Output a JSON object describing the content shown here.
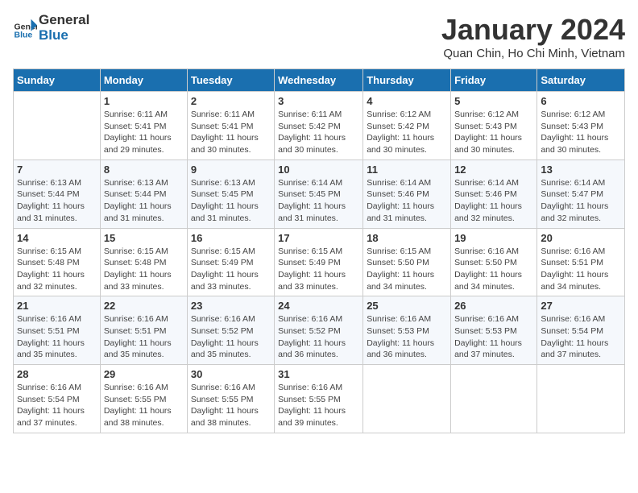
{
  "header": {
    "logo_general": "General",
    "logo_blue": "Blue",
    "month_title": "January 2024",
    "location": "Quan Chin, Ho Chi Minh, Vietnam"
  },
  "days_of_week": [
    "Sunday",
    "Monday",
    "Tuesday",
    "Wednesday",
    "Thursday",
    "Friday",
    "Saturday"
  ],
  "weeks": [
    [
      {
        "day": "",
        "info": ""
      },
      {
        "day": "1",
        "info": "Sunrise: 6:11 AM\nSunset: 5:41 PM\nDaylight: 11 hours\nand 29 minutes."
      },
      {
        "day": "2",
        "info": "Sunrise: 6:11 AM\nSunset: 5:41 PM\nDaylight: 11 hours\nand 30 minutes."
      },
      {
        "day": "3",
        "info": "Sunrise: 6:11 AM\nSunset: 5:42 PM\nDaylight: 11 hours\nand 30 minutes."
      },
      {
        "day": "4",
        "info": "Sunrise: 6:12 AM\nSunset: 5:42 PM\nDaylight: 11 hours\nand 30 minutes."
      },
      {
        "day": "5",
        "info": "Sunrise: 6:12 AM\nSunset: 5:43 PM\nDaylight: 11 hours\nand 30 minutes."
      },
      {
        "day": "6",
        "info": "Sunrise: 6:12 AM\nSunset: 5:43 PM\nDaylight: 11 hours\nand 30 minutes."
      }
    ],
    [
      {
        "day": "7",
        "info": "Sunrise: 6:13 AM\nSunset: 5:44 PM\nDaylight: 11 hours\nand 31 minutes."
      },
      {
        "day": "8",
        "info": "Sunrise: 6:13 AM\nSunset: 5:44 PM\nDaylight: 11 hours\nand 31 minutes."
      },
      {
        "day": "9",
        "info": "Sunrise: 6:13 AM\nSunset: 5:45 PM\nDaylight: 11 hours\nand 31 minutes."
      },
      {
        "day": "10",
        "info": "Sunrise: 6:14 AM\nSunset: 5:45 PM\nDaylight: 11 hours\nand 31 minutes."
      },
      {
        "day": "11",
        "info": "Sunrise: 6:14 AM\nSunset: 5:46 PM\nDaylight: 11 hours\nand 31 minutes."
      },
      {
        "day": "12",
        "info": "Sunrise: 6:14 AM\nSunset: 5:46 PM\nDaylight: 11 hours\nand 32 minutes."
      },
      {
        "day": "13",
        "info": "Sunrise: 6:14 AM\nSunset: 5:47 PM\nDaylight: 11 hours\nand 32 minutes."
      }
    ],
    [
      {
        "day": "14",
        "info": "Sunrise: 6:15 AM\nSunset: 5:48 PM\nDaylight: 11 hours\nand 32 minutes."
      },
      {
        "day": "15",
        "info": "Sunrise: 6:15 AM\nSunset: 5:48 PM\nDaylight: 11 hours\nand 33 minutes."
      },
      {
        "day": "16",
        "info": "Sunrise: 6:15 AM\nSunset: 5:49 PM\nDaylight: 11 hours\nand 33 minutes."
      },
      {
        "day": "17",
        "info": "Sunrise: 6:15 AM\nSunset: 5:49 PM\nDaylight: 11 hours\nand 33 minutes."
      },
      {
        "day": "18",
        "info": "Sunrise: 6:15 AM\nSunset: 5:50 PM\nDaylight: 11 hours\nand 34 minutes."
      },
      {
        "day": "19",
        "info": "Sunrise: 6:16 AM\nSunset: 5:50 PM\nDaylight: 11 hours\nand 34 minutes."
      },
      {
        "day": "20",
        "info": "Sunrise: 6:16 AM\nSunset: 5:51 PM\nDaylight: 11 hours\nand 34 minutes."
      }
    ],
    [
      {
        "day": "21",
        "info": "Sunrise: 6:16 AM\nSunset: 5:51 PM\nDaylight: 11 hours\nand 35 minutes."
      },
      {
        "day": "22",
        "info": "Sunrise: 6:16 AM\nSunset: 5:51 PM\nDaylight: 11 hours\nand 35 minutes."
      },
      {
        "day": "23",
        "info": "Sunrise: 6:16 AM\nSunset: 5:52 PM\nDaylight: 11 hours\nand 35 minutes."
      },
      {
        "day": "24",
        "info": "Sunrise: 6:16 AM\nSunset: 5:52 PM\nDaylight: 11 hours\nand 36 minutes."
      },
      {
        "day": "25",
        "info": "Sunrise: 6:16 AM\nSunset: 5:53 PM\nDaylight: 11 hours\nand 36 minutes."
      },
      {
        "day": "26",
        "info": "Sunrise: 6:16 AM\nSunset: 5:53 PM\nDaylight: 11 hours\nand 37 minutes."
      },
      {
        "day": "27",
        "info": "Sunrise: 6:16 AM\nSunset: 5:54 PM\nDaylight: 11 hours\nand 37 minutes."
      }
    ],
    [
      {
        "day": "28",
        "info": "Sunrise: 6:16 AM\nSunset: 5:54 PM\nDaylight: 11 hours\nand 37 minutes."
      },
      {
        "day": "29",
        "info": "Sunrise: 6:16 AM\nSunset: 5:55 PM\nDaylight: 11 hours\nand 38 minutes."
      },
      {
        "day": "30",
        "info": "Sunrise: 6:16 AM\nSunset: 5:55 PM\nDaylight: 11 hours\nand 38 minutes."
      },
      {
        "day": "31",
        "info": "Sunrise: 6:16 AM\nSunset: 5:55 PM\nDaylight: 11 hours\nand 39 minutes."
      },
      {
        "day": "",
        "info": ""
      },
      {
        "day": "",
        "info": ""
      },
      {
        "day": "",
        "info": ""
      }
    ]
  ]
}
